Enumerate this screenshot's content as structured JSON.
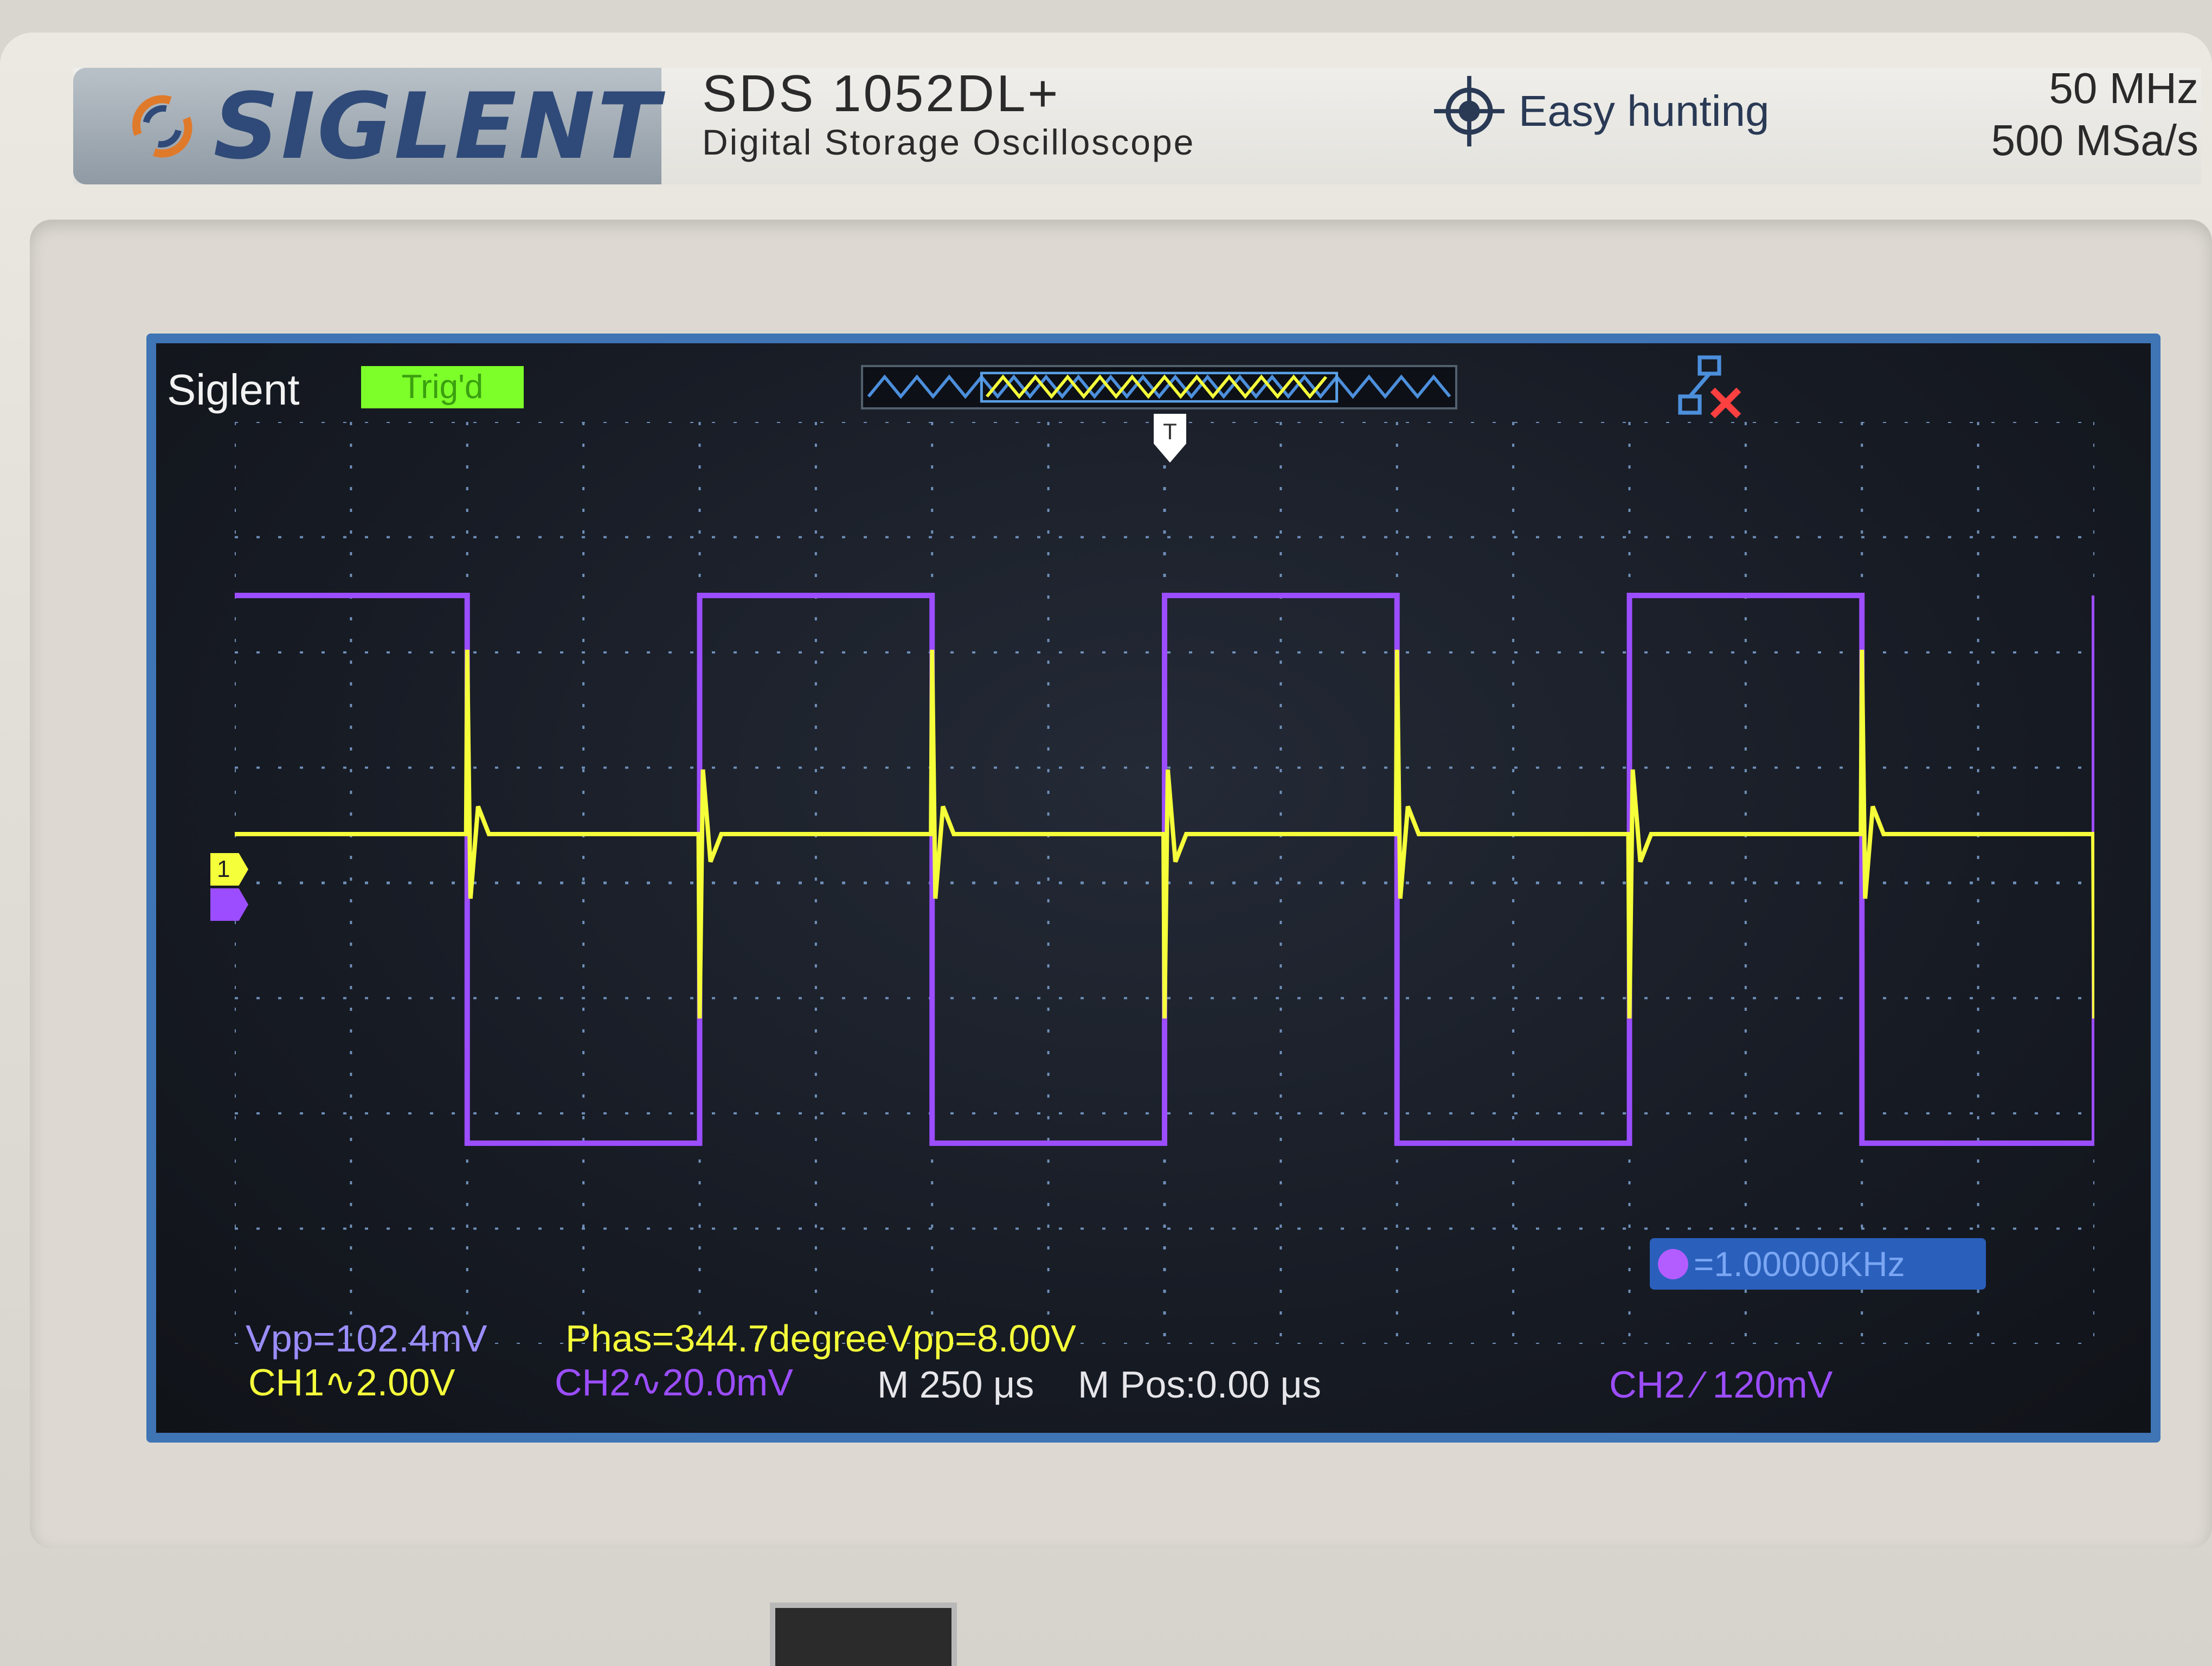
{
  "instrument": {
    "brand_logo_text": "SIGLENT",
    "model_name": "SDS 1052DL+",
    "model_description": "Digital Storage Oscilloscope",
    "feature_label": "Easy hunting",
    "bandwidth": "50 MHz",
    "sample_rate": "500 MSa/s"
  },
  "screen": {
    "brand_label": "Siglent",
    "trigger_status": "Trig'd",
    "trigger_marker": "T",
    "ch1_marker": "1",
    "ch1_vpp": "Vpp=102.4mV",
    "ch1_scale": "CH1∿2.00V",
    "phase_vpp": "Phas=344.7degreeVpp=8.00V",
    "ch2_scale": "CH2∿20.0mV",
    "timebase": "M 250 μs",
    "mpos": "M Pos:0.00 μs",
    "trigger_info": "CH2 ⁄ 120mV",
    "frequency": "=1.00000KHz"
  },
  "colors": {
    "ch1": "#f5ff3a",
    "ch2": "#9b4dff",
    "screen_frame": "#3f74b5",
    "trig_box": "#7dff2a"
  },
  "icons": [
    "siglent-logo-icon",
    "crosshair-icon",
    "network-disconnected-icon",
    "usb-port"
  ]
}
